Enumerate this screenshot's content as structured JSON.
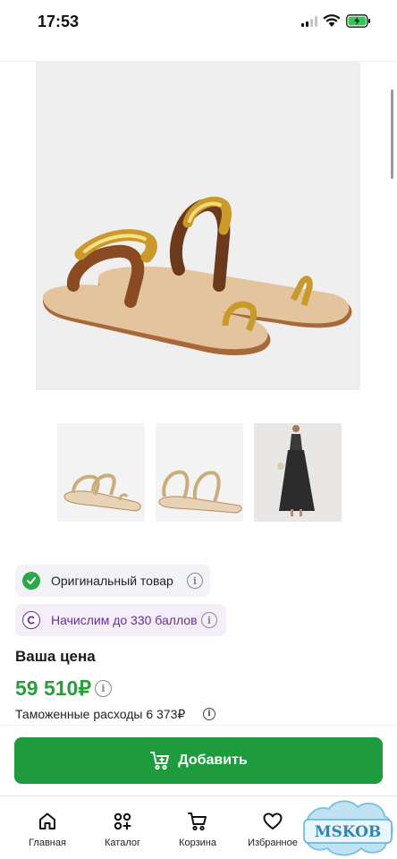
{
  "status_bar": {
    "time": "17:53"
  },
  "product": {
    "main_image_alt": "sandals-with-gold-straps",
    "thumbnails": [
      "sandals-thumb-1",
      "sandals-thumb-2",
      "dress-model-thumb"
    ]
  },
  "badges": {
    "original": "Оригинальный товар",
    "points": "Начислим до 330 баллов"
  },
  "price": {
    "title": "Ваша цена",
    "value": "59 510₽",
    "customs": "Таможенные расходы 6 373₽"
  },
  "actions": {
    "add_label": "Добавить"
  },
  "nav": {
    "items": [
      {
        "label": "Главная",
        "icon": "home-icon"
      },
      {
        "label": "Каталог",
        "icon": "catalog-icon"
      },
      {
        "label": "Корзина",
        "icon": "cart-icon"
      },
      {
        "label": "Избранное",
        "icon": "heart-icon"
      }
    ]
  },
  "watermark": {
    "text": "MSKOB"
  },
  "colors": {
    "accent": "#1e9b3d",
    "price": "#2a9d3b",
    "points": "#6b2d9a"
  }
}
